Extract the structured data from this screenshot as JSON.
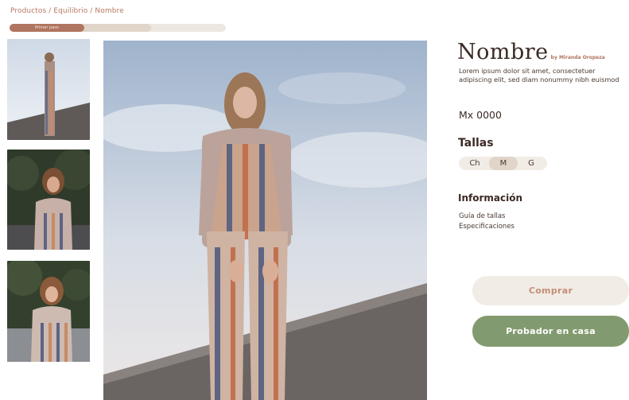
{
  "breadcrumb": "Productos / Equilibrio / Nombre",
  "progress": {
    "step_label": "Primer paso",
    "fraction": 0.34
  },
  "product": {
    "title": "Nombre",
    "byline": "by Miranda Oropeza",
    "description": "Lorem ipsum dolor sit amet, consectetuer adipiscing elit, sed diam nonummy nibh euismod",
    "price": "Mx 0000"
  },
  "sizes": {
    "heading": "Tallas",
    "options": [
      "Ch",
      "M",
      "G"
    ],
    "selected": "M"
  },
  "info": {
    "heading": "Información",
    "links": [
      "Guía de tallas",
      "Especificaciones"
    ]
  },
  "actions": {
    "buy_label": "Comprar",
    "home_trial_label": "Probador en casa"
  },
  "colors": {
    "accent": "#b07560",
    "green": "#829a6f",
    "cream": "#f1ece5"
  }
}
